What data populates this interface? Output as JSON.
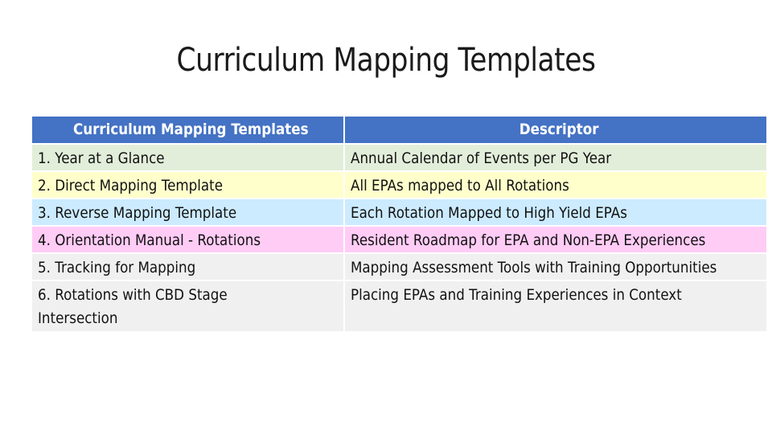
{
  "slide": {
    "title": "Curriculum Mapping Templates"
  },
  "table": {
    "headers": [
      "Curriculum Mapping Templates",
      "Descriptor"
    ],
    "header_color": "#4472C4",
    "rows": [
      {
        "template": "1. Year at a Glance",
        "descriptor": "Annual Calendar of Events per PG Year",
        "color": "#E2EEDA"
      },
      {
        "template": "2. Direct Mapping Template",
        "descriptor": "All EPAs mapped to All Rotations",
        "color": "#FFFFCC"
      },
      {
        "template": "3. Reverse Mapping Template",
        "descriptor": "Each Rotation Mapped to High Yield EPAs",
        "color": "#CCEBFF"
      },
      {
        "template": "4. Orientation Manual - Rotations",
        "descriptor": "Resident Roadmap for EPA and Non-EPA Experiences",
        "color": "#FFCCF5"
      },
      {
        "template": "5. Tracking for Mapping",
        "descriptor": "Mapping Assessment Tools with Training Opportunities",
        "color": "#F0F0F0"
      },
      {
        "template": "6. Rotations with CBD Stage Intersection",
        "descriptor": "Placing EPAs and Training Experiences in Context",
        "color": "#F0F0F0"
      }
    ]
  }
}
